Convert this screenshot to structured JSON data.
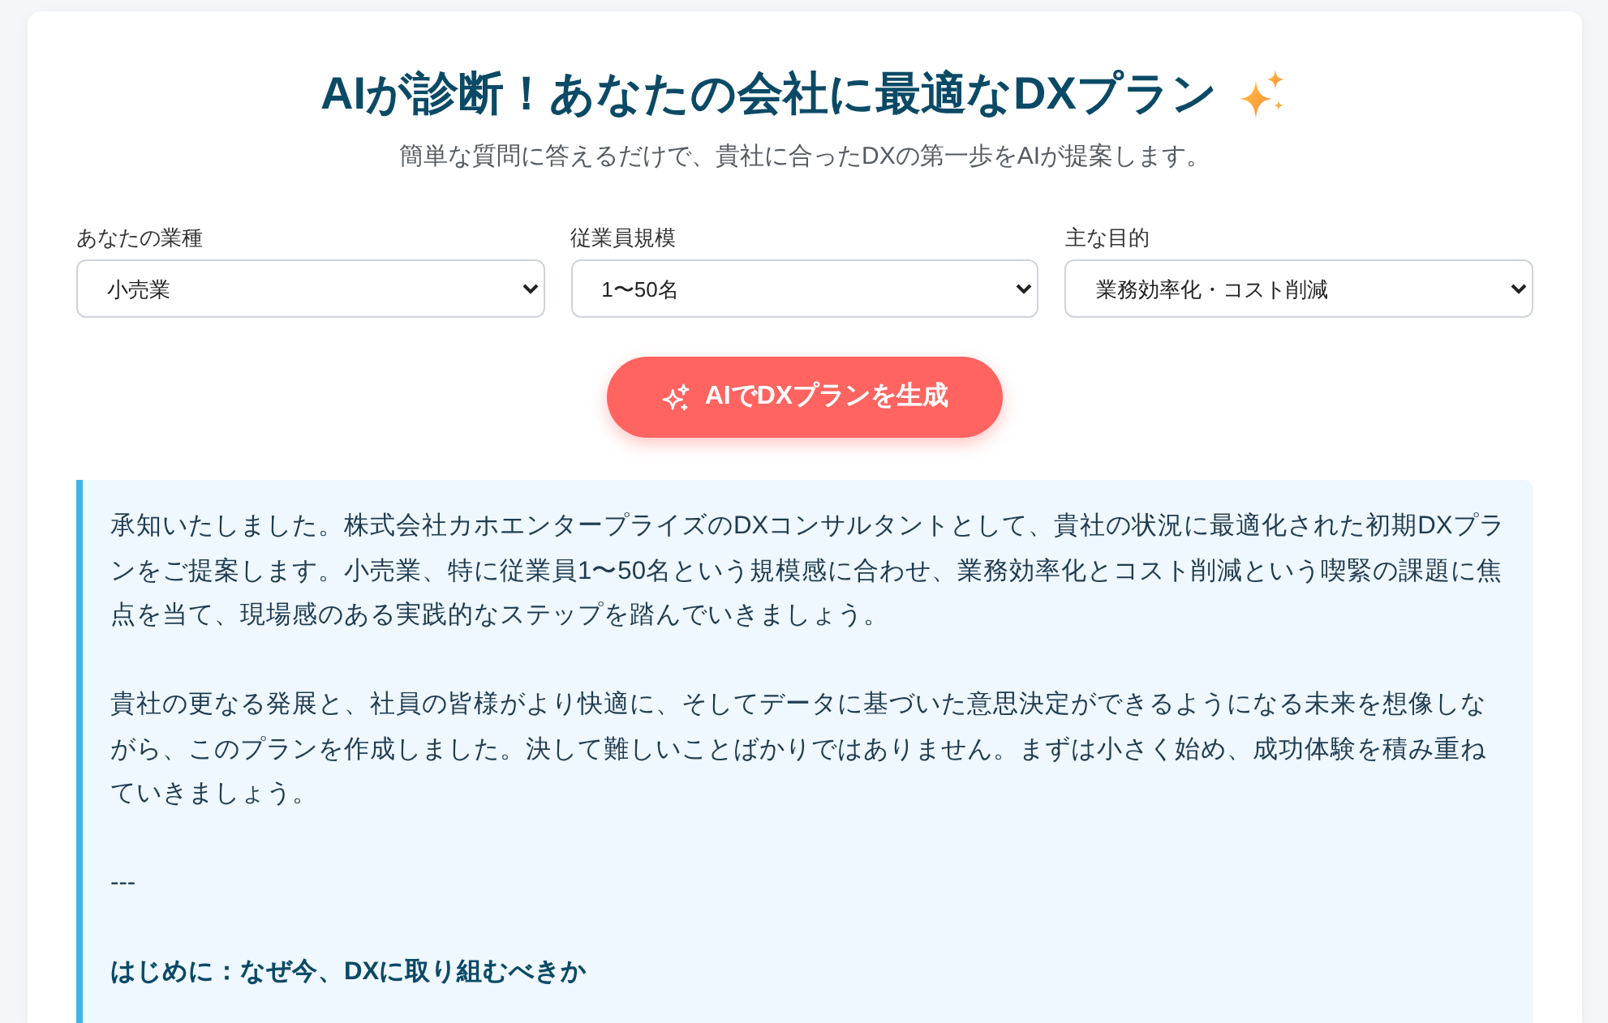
{
  "header": {
    "title": "AIが診断！あなたの会社に最適なDXプラン",
    "subtitle": "簡単な質問に答えるだけで、貴社に合ったDXの第一歩をAIが提案します。"
  },
  "fields": [
    {
      "label": "あなたの業種",
      "value": "小売業"
    },
    {
      "label": "従業員規模",
      "value": "1〜50名"
    },
    {
      "label": "主な目的",
      "value": "業務効率化・コスト削減"
    }
  ],
  "generate_button": {
    "label": "AIでDXプランを生成"
  },
  "result": {
    "blocks": [
      {
        "kind": "paragraph",
        "text": "承知いたしました。株式会社カホエンタープライズのDXコンサルタントとして、貴社の状況に最適化された初期DXプランをご提案します。小売業、特に従業員1〜50名という規模感に合わせ、業務効率化とコスト削減という喫緊の課題に焦点を当て、現場感のある実践的なステップを踏んでいきましょう。"
      },
      {
        "kind": "paragraph",
        "text": "貴社の更なる発展と、社員の皆様がより快適に、そしてデータに基づいた意思決定ができるようになる未来を想像しながら、このプランを作成しました。決して難しいことばかりではありません。まずは小さく始め、成功体験を積み重ねていきましょう。"
      },
      {
        "kind": "paragraph",
        "text": "---"
      },
      {
        "kind": "heading",
        "text": "はじめに：なぜ今、DXに取り組むべきか"
      }
    ]
  }
}
